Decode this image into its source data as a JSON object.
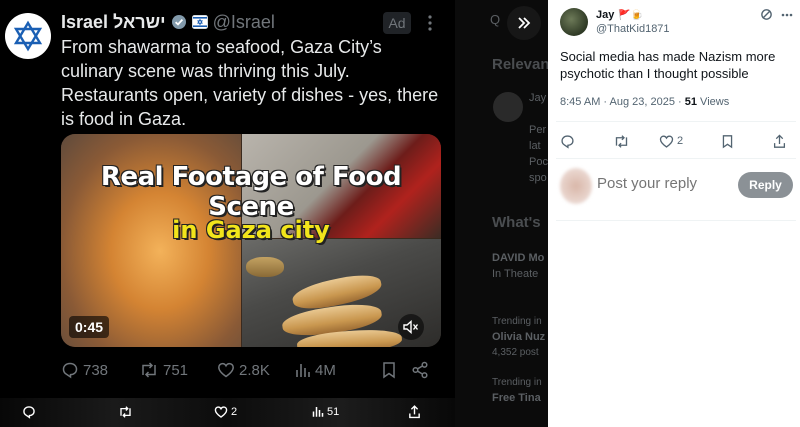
{
  "tweet": {
    "author_name": "Israel ישראל",
    "author_handle": "@Israel",
    "ad_label": "Ad",
    "text": "From shawarma to seafood, Gaza City’s culinary scene was thriving this July. Restaurants open, variety of dishes - yes, there is food in Gaza.",
    "media": {
      "title_line1": "Real Footage of Food Scene",
      "title_line2": "in Gaza city",
      "duration": "0:45"
    },
    "actions": {
      "replies": "738",
      "reposts": "751",
      "likes": "2.8K",
      "views": "4M"
    },
    "icons": {
      "avatar": "star-of-david-icon",
      "verified": "verified-badge-icon",
      "affiliate": "flag-badge-icon",
      "more": "more-dots-icon"
    }
  },
  "bottom_bar": {
    "likes": "2",
    "views": "51"
  },
  "background_sidebar": {
    "search_glyph": "Q",
    "relevant_heading": "Relevan",
    "whats_heading": "What's",
    "item1": "DAVID Mo",
    "item1_sub": "In Theate",
    "item2": "Olivia Nuz",
    "item3": "Free Tina",
    "frag_jay": "Jay",
    "frag_per": "Per",
    "frag_lat": "lat",
    "frag_poc": "Poc",
    "frag_spo": "spo",
    "frag_trending": "Trending in",
    "frag_4": "4,352 post",
    "frag_trending2": "Trending in"
  },
  "reply_panel": {
    "author_name": "Jay",
    "author_emoji": "🚩🍺",
    "author_handle": "@ThatKid1871",
    "text": "Social media has made Nazism more psychotic than I thought possible",
    "time": "8:45 AM · Aug 23, 2025 · ",
    "views_count": "51",
    "views_label": " Views",
    "likes": "2",
    "reply_placeholder": "Post your reply",
    "reply_button": "Reply"
  },
  "colors": {
    "accent": "#1d9bf0",
    "reply_button": "#8b9196",
    "dark_bg": "#000000",
    "dark_text": "#e7e9ea",
    "muted_text": "#71767b"
  }
}
